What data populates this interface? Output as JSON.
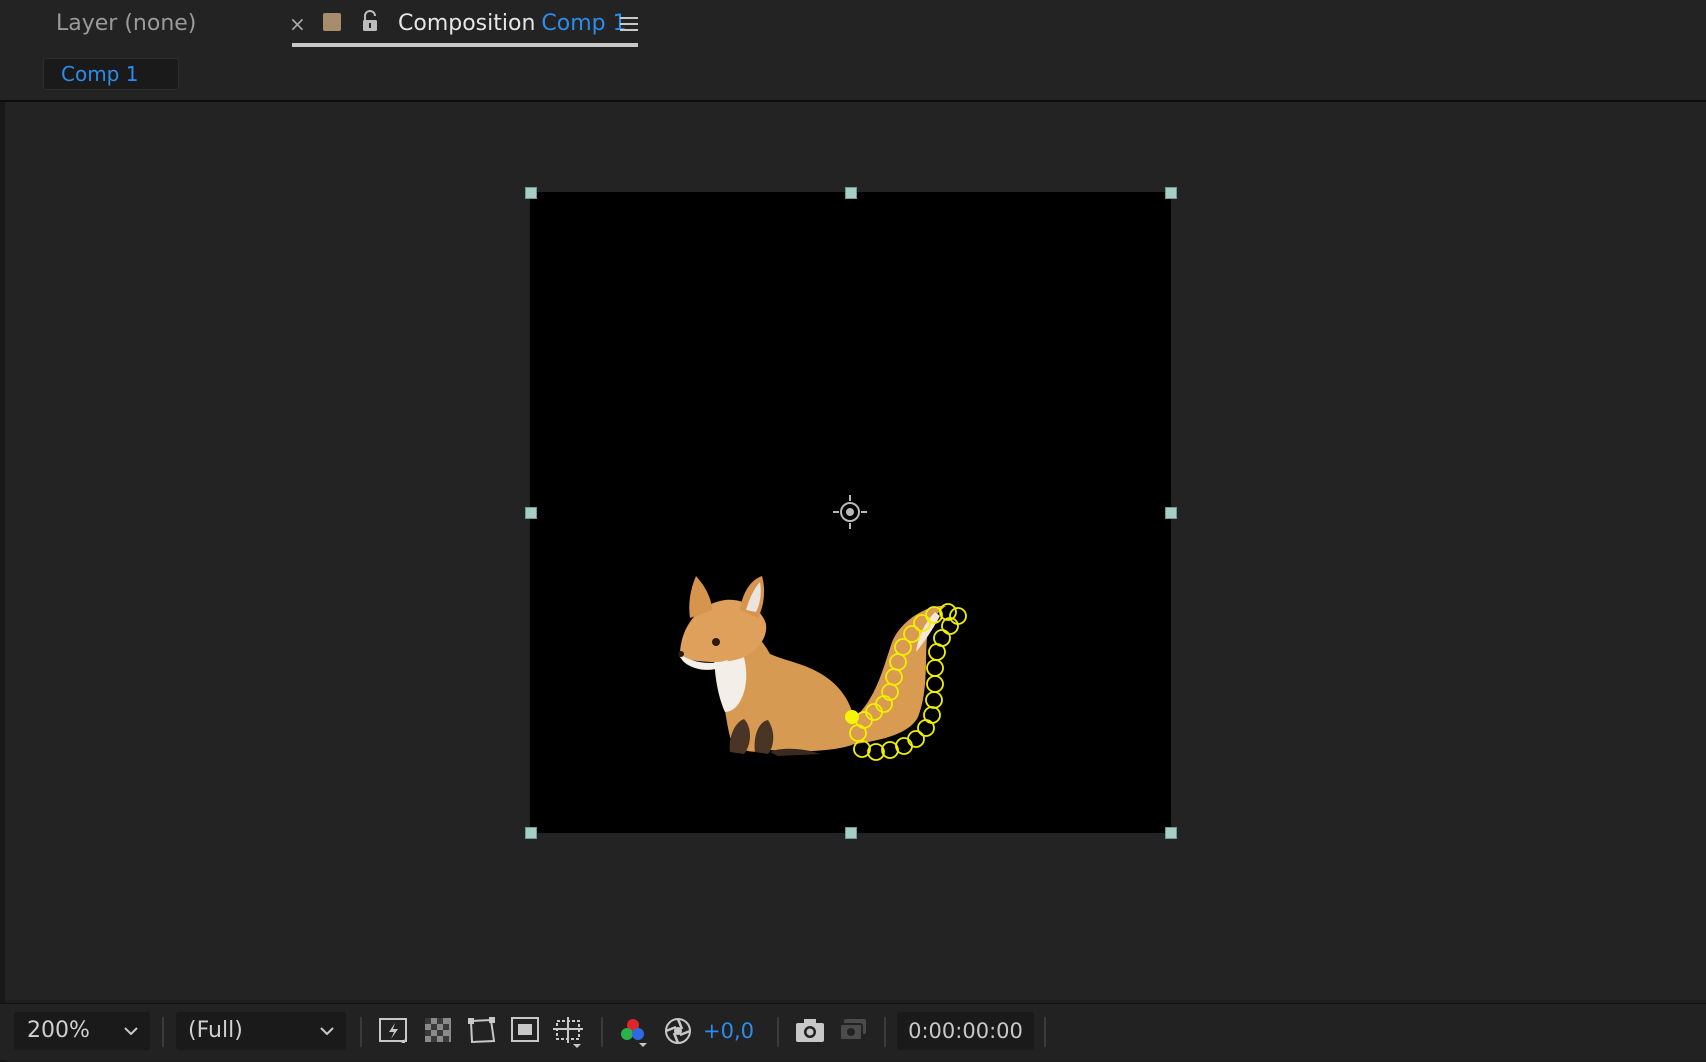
{
  "tabs": {
    "layer_tab": "Layer (none)",
    "close_symbol": "×",
    "composition_label": "Composition",
    "composition_name": "Comp 1"
  },
  "subbar": {
    "comp_chip": "Comp 1"
  },
  "viewer_controls": {
    "zoom": "200%",
    "resolution": "(Full)",
    "exposure": "+0,0",
    "timecode": "0:00:00:00"
  },
  "icons": {
    "label_color": "label-swatch",
    "lock": "lock-open-icon",
    "panel_menu": "hamburger-menu-icon",
    "anchor": "anchor-point-icon",
    "toolbar": [
      "fast-previews-icon",
      "transparency-grid-icon",
      "mask-visibility-icon",
      "region-of-interest-icon",
      "guides-options-icon",
      "color-channels-icon",
      "reset-exposure-icon",
      "snapshot-icon",
      "show-snapshot-icon"
    ]
  },
  "colors": {
    "accent": "#2d8ceb",
    "label_swatch": "#a88d6c",
    "handles": "#a8cdc7",
    "mesh_pins": "#f0f000"
  }
}
